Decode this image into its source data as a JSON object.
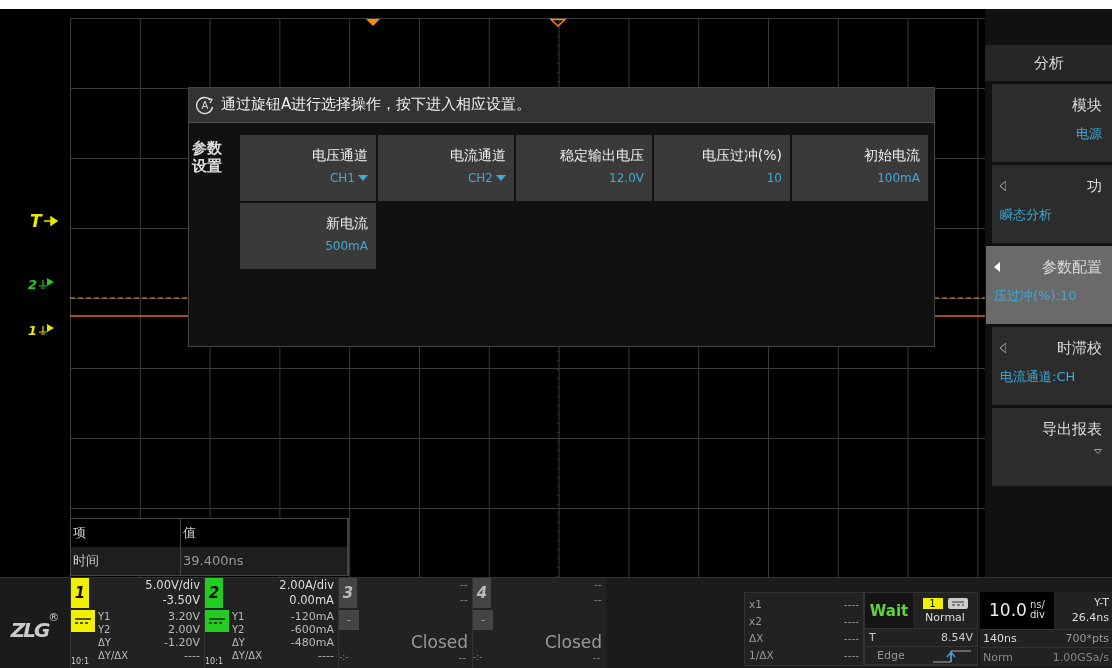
{
  "screen": {
    "trigger_marker": "T",
    "channel_markers": [
      {
        "label": "2",
        "color": "#22cc22"
      },
      {
        "label": "1",
        "color": "#e8e800"
      }
    ]
  },
  "dialog": {
    "knob": "A",
    "hint": "通过旋钮A进行选择操作，按下进入相应设置。",
    "section_label": "参数设置",
    "params": [
      {
        "label": "电压通道",
        "value": "CH1",
        "kind": "dropdown"
      },
      {
        "label": "电流通道",
        "value": "CH2",
        "kind": "dropdown"
      },
      {
        "label": "稳定输出电压",
        "value": "12.0V",
        "kind": "value"
      },
      {
        "label": "电压过冲(%)",
        "value": "10",
        "kind": "value"
      },
      {
        "label": "初始电流",
        "value": "100mA",
        "kind": "value"
      },
      {
        "label": "新电流",
        "value": "500mA",
        "kind": "value"
      }
    ]
  },
  "measurements": {
    "columns": [
      "项",
      "值"
    ],
    "rows": [
      [
        "时间",
        "39.400ns"
      ]
    ]
  },
  "analysis_menu": {
    "title": "分析",
    "items": [
      {
        "label": "模块",
        "value": "电源",
        "kind": "value",
        "selected": false
      },
      {
        "label": "功",
        "value": "瞬态分析",
        "kind": "submenu",
        "selected": false
      },
      {
        "label": "参数配置",
        "value": "压过冲(%):10",
        "kind": "submenu",
        "selected": true
      },
      {
        "label": "时滞校",
        "value": "电流通道:CH",
        "kind": "submenu",
        "selected": false
      },
      {
        "label": "导出报表",
        "kind": "dropdown",
        "selected": false
      }
    ]
  },
  "logo": {
    "text": "ZLG",
    "mark": "®"
  },
  "channels": [
    {
      "number": "1",
      "kind": "open",
      "color": "#f0f000",
      "scale": "5.00V/div",
      "offset": "-3.50V",
      "probe": "10:1",
      "readings": [
        {
          "label": "Y1",
          "value": "3.20V"
        },
        {
          "label": "Y2",
          "value": "2.00V"
        },
        {
          "label": "ΔY",
          "value": "-1.20V"
        },
        {
          "label": "ΔY/ΔX",
          "value": "----"
        }
      ]
    },
    {
      "number": "2",
      "kind": "open",
      "color": "#22cc22",
      "scale": "2.00A/div",
      "offset": "0.00mA",
      "probe": "10:1",
      "readings": [
        {
          "label": "Y1",
          "value": "-120mA"
        },
        {
          "label": "Y2",
          "value": "-600mA"
        },
        {
          "label": "ΔY",
          "value": "-480mA"
        },
        {
          "label": "ΔY/ΔX",
          "value": "----"
        }
      ]
    },
    {
      "number": "3",
      "kind": "closed",
      "scale": "--",
      "offset": "--",
      "coupling": "-",
      "status": "Closed",
      "ratio": "-:-",
      "reading": "--"
    },
    {
      "number": "4",
      "kind": "closed",
      "scale": "--",
      "offset": "--",
      "coupling": "-",
      "status": "Closed",
      "ratio": "-:-",
      "reading": "--"
    }
  ],
  "cursors": [
    {
      "label": "x1",
      "value": "----"
    },
    {
      "label": "x2",
      "value": "----"
    },
    {
      "label": "ΔX",
      "value": "----"
    },
    {
      "label": "1/ΔX",
      "value": "----"
    }
  ],
  "trigger": {
    "state": "Wait",
    "source": "1",
    "mode": "Normal",
    "threshold_label": "T",
    "threshold": "8.54V",
    "type": "Edge"
  },
  "timebase": {
    "scale": "10.0",
    "unit_top": "ns/",
    "unit_bottom": "div",
    "mode": "Y-T",
    "delay": "26.4ns",
    "span": "140ns",
    "points": "700*pts",
    "acquire": "Norm",
    "rate": "1.00GSa/s"
  }
}
